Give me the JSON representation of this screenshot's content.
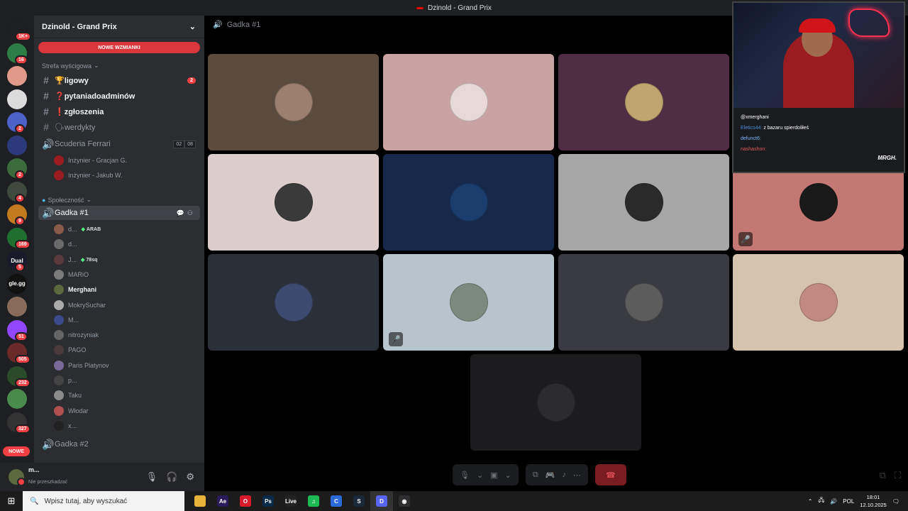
{
  "window": {
    "title": "Dzinold - Grand Prix"
  },
  "guilds": [
    {
      "icon": "discord-home-icon",
      "badge": "1K+",
      "color": "#1e1f22"
    },
    {
      "icon": "server-icon",
      "badge": "16",
      "color": "#2d7d46"
    },
    {
      "icon": "server-icon",
      "badge": "",
      "color": "#e19a8a"
    },
    {
      "icon": "server-icon",
      "badge": "",
      "color": "#dcdcdc"
    },
    {
      "icon": "server-icon",
      "badge": "2",
      "color": "#4d62c9"
    },
    {
      "icon": "server-icon",
      "badge": "",
      "color": "#2c3a7c"
    },
    {
      "icon": "server-icon",
      "badge": "2",
      "color": "#3b6b3b"
    },
    {
      "icon": "server-icon",
      "badge": "4",
      "color": "#3e4a3e"
    },
    {
      "icon": "server-icon",
      "badge": "9",
      "color": "#c47a1e"
    },
    {
      "icon": "server-icon",
      "badge": "169",
      "color": "#1f6f2f"
    },
    {
      "icon": "server-icon",
      "label": "Dual",
      "badge": "5",
      "color": "#1a1a2a"
    },
    {
      "icon": "server-icon",
      "label": "gle.gg",
      "badge": "",
      "color": "#111"
    },
    {
      "icon": "server-icon",
      "badge": "",
      "color": "#8a6a5a"
    },
    {
      "icon": "server-icon",
      "badge": "51",
      "color": "#9146ff"
    },
    {
      "icon": "server-icon",
      "badge": "505",
      "color": "#6a2a2a"
    },
    {
      "icon": "server-icon",
      "badge": "232",
      "color": "#2a4a2a"
    },
    {
      "icon": "server-icon",
      "badge": "",
      "color": "#4a8a4a"
    },
    {
      "icon": "server-icon",
      "badge": "327",
      "color": "#333"
    }
  ],
  "guild_new_label": "NOWE",
  "server": {
    "name": "Dzinold - Grand Prix",
    "mention_banner": "NOWE WZMIANKI",
    "category_racing": "Strefa wyścigowa",
    "channels": [
      {
        "name": "🏆ligowy",
        "badge": "2",
        "unread": true
      },
      {
        "name": "❓pytaniadoadminów",
        "badge": "",
        "unread": true
      },
      {
        "name": "❗zgłoszenia",
        "badge": "",
        "unread": true
      },
      {
        "name": "🗣werdykty",
        "badge": "",
        "unread": false
      }
    ],
    "voice_ferrari": {
      "name": "Scuderia Ferrari",
      "count1": "02",
      "count2": "08",
      "members": [
        "Inżynier - Gracjan G.",
        "Inżynier - Jakub W."
      ]
    },
    "category_community": "Społeczność",
    "voice_gadka1": {
      "name": "Gadka #1"
    },
    "gadka_members": [
      {
        "name": "d...",
        "tag": "ARAB"
      },
      {
        "name": "d...",
        "tag": ""
      },
      {
        "name": "J...",
        "tag": "78sq"
      },
      {
        "name": "MARiO",
        "tag": ""
      },
      {
        "name": "Merghani",
        "tag": "",
        "bold": true
      },
      {
        "name": "MokrySuchar",
        "tag": ""
      },
      {
        "name": "M...",
        "tag": ""
      },
      {
        "name": "nitrozyniak",
        "tag": ""
      },
      {
        "name": "PAGO",
        "tag": ""
      },
      {
        "name": "Paris Platynov",
        "tag": ""
      },
      {
        "name": "p...",
        "tag": ""
      },
      {
        "name": "Taku",
        "tag": ""
      },
      {
        "name": "Włodar",
        "tag": ""
      },
      {
        "name": "x...",
        "tag": ""
      }
    ],
    "voice_gadka2": {
      "name": "Gadka #2"
    }
  },
  "user_panel": {
    "name": "m...",
    "status": "Nie przeszkadzać"
  },
  "voice_view": {
    "channel": "Gadka #1"
  },
  "tiles": [
    {
      "bg": "#5b4a3e",
      "avatar": "#9c7f6e",
      "muted": false
    },
    {
      "bg": "#c9a2a3",
      "avatar": "#e8d8d8",
      "muted": false
    },
    {
      "bg": "#4f2d42",
      "avatar": "#c0a56e",
      "muted": false
    },
    {
      "bg": "#dccdcd",
      "avatar": "#3a3a3a",
      "muted": false
    },
    {
      "bg": "#16294a",
      "avatar": "#1b3d6b",
      "muted": false
    },
    {
      "bg": "#a6a6a6",
      "avatar": "#2a2a2a",
      "muted": false
    },
    {
      "bg": "#c47874",
      "avatar": "#1a1a1a",
      "muted": true
    },
    {
      "bg": "#2b2f38",
      "avatar": "#3e4a70",
      "muted": false
    },
    {
      "bg": "#b8c4cc",
      "avatar": "#7a8a7e",
      "muted": true
    },
    {
      "bg": "#3a3b42",
      "avatar": "#5c5c5c",
      "muted": false
    },
    {
      "bg": "#d6c3ad",
      "avatar": "#c08a80",
      "muted": false
    },
    {
      "bg": "#1c1c1e",
      "avatar": "#2c2c2e",
      "muted": false
    }
  ],
  "stream_chat": [
    {
      "user": "@xmerghani",
      "color": "#ffffff",
      "text": ""
    },
    {
      "user": "Eletics44:",
      "color": "#4a90e2",
      "text": "z bazaru spierdoliłeś"
    },
    {
      "user": "defunct6:",
      "color": "#7fb3ff",
      "text": ""
    },
    {
      "user": "nashashon:",
      "color": "#e05a5a",
      "text": ""
    }
  ],
  "stream_logo": "MRGH.",
  "taskbar": {
    "search_placeholder": "Wpisz tutaj, aby wyszukać",
    "apps": [
      {
        "name": "file-explorer-icon",
        "label": "",
        "color": "#e8b43a"
      },
      {
        "name": "after-effects-icon",
        "label": "Ae",
        "color": "#2a1a5a"
      },
      {
        "name": "opera-icon",
        "label": "O",
        "color": "#d81b2a"
      },
      {
        "name": "photoshop-icon",
        "label": "Ps",
        "color": "#0a2a4a"
      },
      {
        "name": "live-icon",
        "label": "Live",
        "color": "#222"
      },
      {
        "name": "spotify-icon",
        "label": "♫",
        "color": "#1db954"
      },
      {
        "name": "ccleaner-icon",
        "label": "C",
        "color": "#2a6ad9"
      },
      {
        "name": "steam-icon",
        "label": "S",
        "color": "#1b2838"
      },
      {
        "name": "discord-icon",
        "label": "D",
        "color": "#5865f2"
      },
      {
        "name": "obs-icon",
        "label": "◉",
        "color": "#302e31"
      }
    ],
    "lang": "POL",
    "time": "18:01",
    "date": "12.10.2025"
  }
}
